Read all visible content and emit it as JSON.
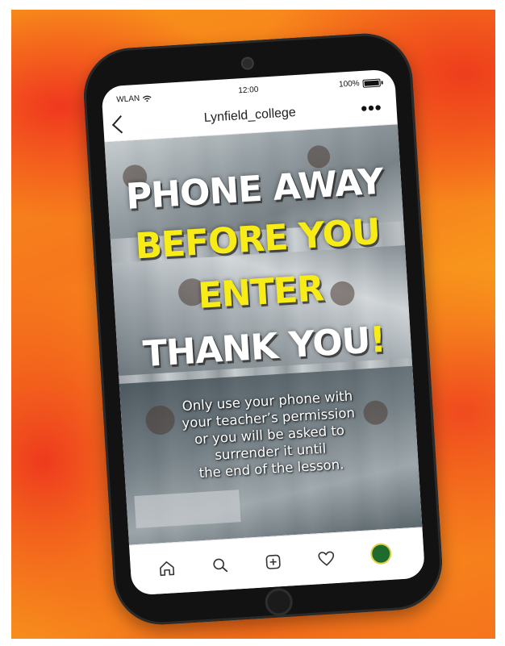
{
  "status": {
    "network": "WLAN",
    "time": "12:00",
    "battery": "100%"
  },
  "header": {
    "account": "Lynfield_college",
    "more": "•••"
  },
  "post": {
    "line1": "PHONE AWAY",
    "line2": "BEFORE YOU",
    "line3": "ENTER",
    "line4": "THANK YOU",
    "line4_mark": "!",
    "body_lines": [
      "Only use your phone with",
      "your teacher’s permission",
      "or you will be asked to",
      "surrender it until",
      "the end of the lesson."
    ]
  },
  "icons": {
    "nav": [
      "home-icon",
      "search-icon",
      "add-icon",
      "heart-icon",
      "profile-avatar"
    ]
  },
  "colors": {
    "accent_yellow": "#f7ec17",
    "background_orange": "#f6781c",
    "background_red": "#ee3a1d",
    "phone_black": "#121212"
  }
}
